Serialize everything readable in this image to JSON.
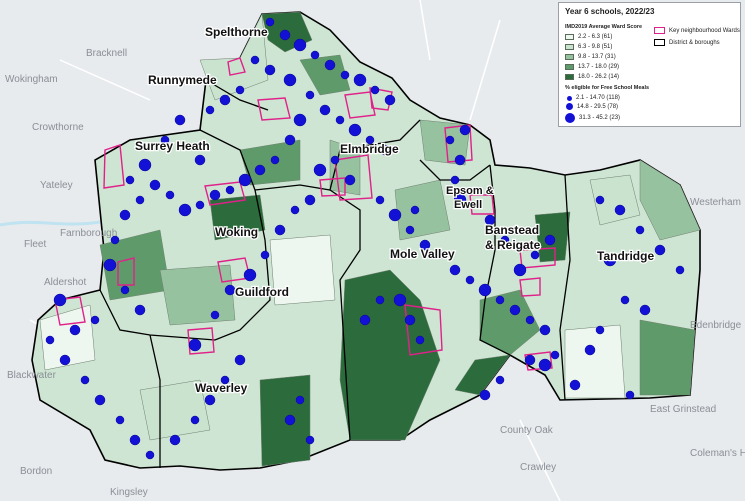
{
  "legend": {
    "title": "Year 6 schools, 2022/23",
    "imd_title": "IMD2019 Average Ward Score",
    "imd_classes": [
      {
        "label": "2.2 - 6.3 (61)",
        "color": "#edf7ef"
      },
      {
        "label": "6.3 - 9.8 (51)",
        "color": "#c9e3cf"
      },
      {
        "label": "9.8 - 13.7 (31)",
        "color": "#97c29f"
      },
      {
        "label": "13.7 - 18.0 (29)",
        "color": "#5f9b6a"
      },
      {
        "label": "18.0 - 26.2 (14)",
        "color": "#2c6b3c"
      }
    ],
    "fsm_title": "% eligible for Free School Meals",
    "fsm_classes": [
      {
        "label": "2.1 - 14.70 (118)"
      },
      {
        "label": "14.8 - 29.5 (78)"
      },
      {
        "label": "31.3 - 45.2 (23)"
      }
    ],
    "key_wards_label": "Key neighbourhood Wards",
    "key_wards_color": "#e0218a",
    "district_label": "District & boroughs",
    "district_color": "#000000",
    "school_color": "#1411d6"
  },
  "districts": {
    "spelthorne": "Spelthorne",
    "runnymede": "Runnymede",
    "surrey_heath": "Surrey Heath",
    "elmbridge": "Elmbridge",
    "epsom_ewell_1": "Epsom &",
    "epsom_ewell_2": "Ewell",
    "woking": "Woking",
    "banstead_1": "Banstead",
    "banstead_2": "& Reigate",
    "mole_valley": "Mole Valley",
    "tandridge": "Tandridge",
    "guildford": "Guildford",
    "waverley": "Waverley"
  },
  "places": {
    "wokingham": "Wokingham",
    "bracknell": "Bracknell",
    "crowthorne": "Crowthorne",
    "yateley": "Yateley",
    "fleet": "Fleet",
    "farnborough": "Farnborough",
    "aldershot": "Aldershot",
    "blackwater": "Blackwater",
    "bordon": "Bordon",
    "crawley": "Crawley",
    "east_grinstead": "East Grinstead",
    "county_oak": "County Oak",
    "kingsley": "Kingsley",
    "westerham": "Westerham",
    "edenbridge": "Edenbridge",
    "coleman_hatch": "Coleman's Hatch"
  }
}
